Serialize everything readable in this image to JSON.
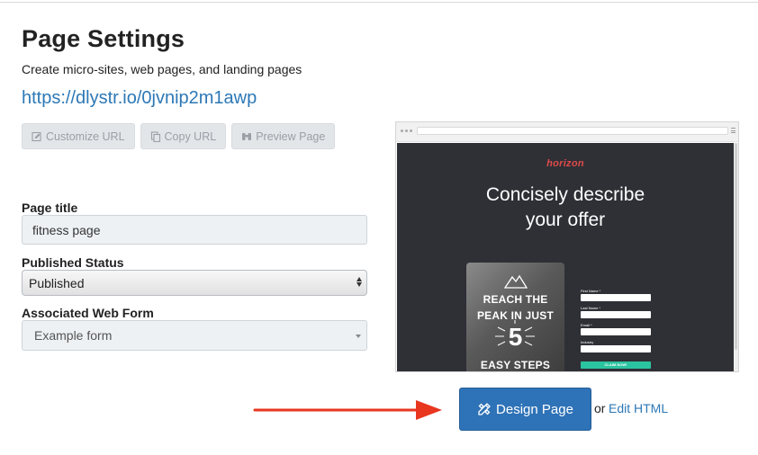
{
  "header": {
    "title": "Page Settings",
    "subtitle": "Create micro-sites, web pages, and landing pages",
    "url": "https://dlystr.io/0jvnip2m1awp"
  },
  "url_actions": [
    {
      "label": "Customize URL",
      "icon": "edit-icon"
    },
    {
      "label": "Copy URL",
      "icon": "copy-icon"
    },
    {
      "label": "Preview Page",
      "icon": "binoculars-icon"
    }
  ],
  "form": {
    "page_title_label": "Page title",
    "page_title_value": "fitness page",
    "status_label": "Published Status",
    "status_value": "Published",
    "web_form_label": "Associated Web Form",
    "web_form_value": "Example form"
  },
  "preview": {
    "brand": "horizon",
    "headline_line1": "Concisely describe",
    "headline_line2": "your offer",
    "book_line1": "REACH THE",
    "book_line2": "PEAK IN JUST",
    "book_number": "5",
    "book_line3": "EASY STEPS",
    "form_labels": [
      "First Name *",
      "Last Name *",
      "Email *",
      "Industry"
    ],
    "form_button": "CLAIM NOW!",
    "brand_color": "#e04a4a",
    "button_color": "#2bc4a0"
  },
  "actions": {
    "design_label": "Design Page",
    "or_text": "or",
    "edit_html_label": "Edit HTML",
    "primary_color": "#2e72b7",
    "arrow_color": "#e8361f"
  }
}
